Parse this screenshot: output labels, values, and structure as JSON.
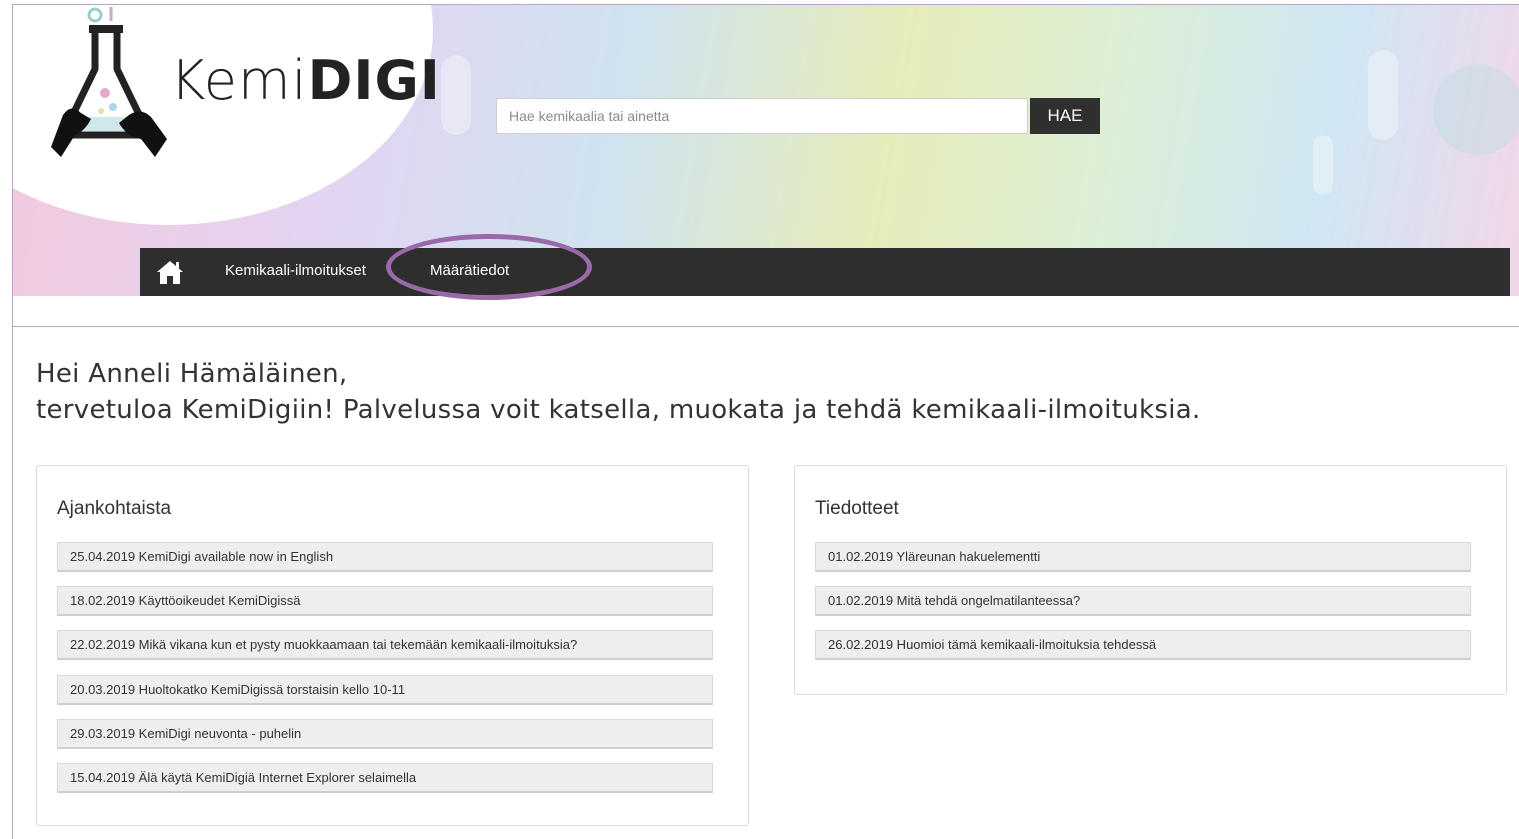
{
  "header": {
    "logo": {
      "text_light": "Kemi",
      "text_bold": "DIGI"
    },
    "search": {
      "placeholder": "Hae kemikaalia tai ainetta",
      "button_label": "HAE"
    }
  },
  "nav": {
    "home_icon": "home-icon",
    "items": [
      {
        "label": "Kemikaali-ilmoitukset"
      },
      {
        "label": "Määrätiedot",
        "highlighted": true
      }
    ]
  },
  "greeting": {
    "line1": "Hei Anneli Hämäläinen,",
    "line2": "tervetuloa KemiDigiin! Palvelussa voit katsella, muokata ja tehdä kemikaali-ilmoituksia."
  },
  "panels": {
    "ajankohtaista": {
      "title": "Ajankohtaista",
      "items": [
        "25.04.2019 KemiDigi available now in English",
        "18.02.2019 Käyttöoikeudet KemiDigissä",
        "22.02.2019 Mikä vikana kun et pysty muokkaamaan tai tekemään kemikaali-ilmoituksia?",
        "20.03.2019 Huoltokatko KemiDigissä torstaisin kello 10-11",
        "29.03.2019 KemiDigi neuvonta - puhelin",
        "15.04.2019 Älä käytä KemiDigiä Internet Explorer selaimella"
      ]
    },
    "tiedotteet": {
      "title": "Tiedotteet",
      "items": [
        "01.02.2019 Yläreunan hakuelementti",
        "01.02.2019 Mitä tehdä ongelmatilanteessa?",
        "26.02.2019 Huomioi tämä kemikaali-ilmoituksia tehdessä"
      ]
    }
  },
  "colors": {
    "navbar": "#2e2e2e",
    "highlight": "#9a6aa8",
    "search_button": "#2f2f2f"
  }
}
